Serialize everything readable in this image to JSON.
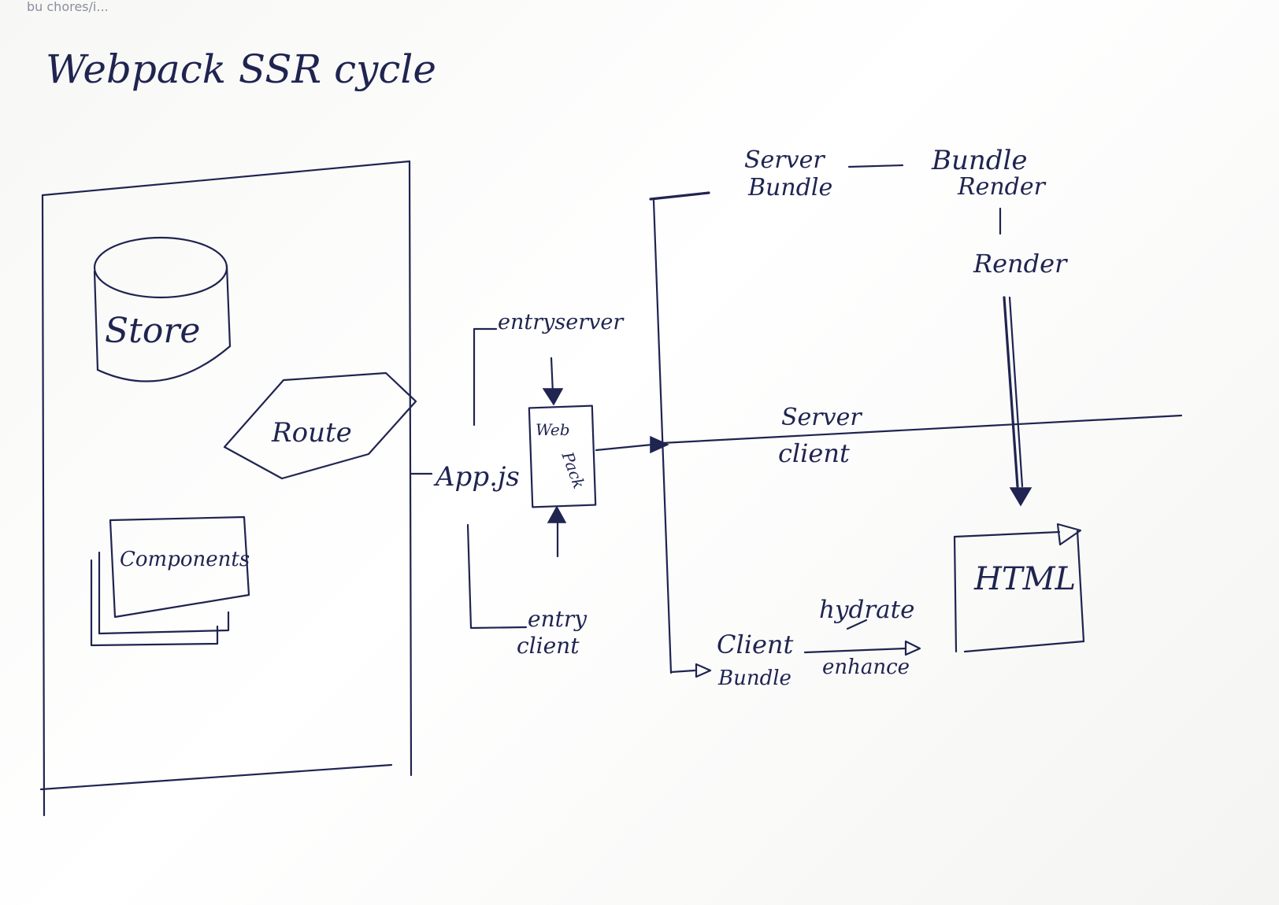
{
  "header_scrap": "bu chores/i...",
  "title": "Webpack SSR cycle",
  "app_box": {
    "store": "Store",
    "route": "Route",
    "components": "Components"
  },
  "app_js": "App.js",
  "entry_server": "entryserver",
  "entry_client_line1": "entry",
  "entry_client_line2": "client",
  "webpack_line1": "Web",
  "webpack_line2": "Pack",
  "server_bundle_line1": "Server",
  "server_bundle_line2": "Bundle",
  "bundle_render_line1": "Bundle",
  "bundle_render_line2": "Render",
  "render": "Render",
  "divider_top": "Server",
  "divider_bottom": "client",
  "client_bundle_line1": "Client",
  "client_bundle_line2": "Bundle",
  "hydrate": "hydrate",
  "enhance": "enhance",
  "html": "HTML"
}
